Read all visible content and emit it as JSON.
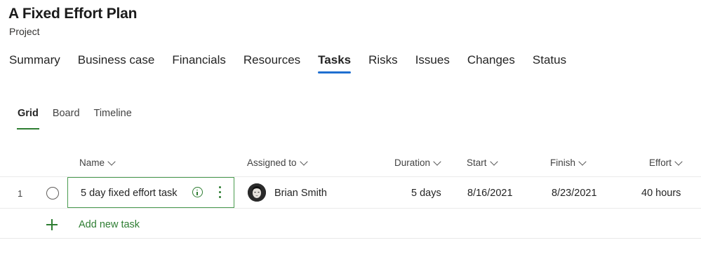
{
  "project": {
    "title": "A Fixed Effort Plan",
    "subtitle": "Project"
  },
  "tabs": [
    {
      "label": "Summary"
    },
    {
      "label": "Business case"
    },
    {
      "label": "Financials"
    },
    {
      "label": "Resources"
    },
    {
      "label": "Tasks",
      "active": true
    },
    {
      "label": "Risks"
    },
    {
      "label": "Issues"
    },
    {
      "label": "Changes"
    },
    {
      "label": "Status"
    }
  ],
  "views": [
    {
      "label": "Grid",
      "active": true
    },
    {
      "label": "Board"
    },
    {
      "label": "Timeline"
    }
  ],
  "columns": {
    "name": "Name",
    "assigned": "Assigned to",
    "duration": "Duration",
    "start": "Start",
    "finish": "Finish",
    "effort": "Effort"
  },
  "tasks": [
    {
      "number": "1",
      "name": "5 day fixed effort task",
      "assigned_to": "Brian Smith",
      "duration": "5 days",
      "start": "8/16/2021",
      "finish": "8/23/2021",
      "effort": "40 hours"
    }
  ],
  "add_task_label": "Add new task",
  "colors": {
    "accent_green": "#2e7d32",
    "tab_underline_blue": "#1f6fd0"
  }
}
